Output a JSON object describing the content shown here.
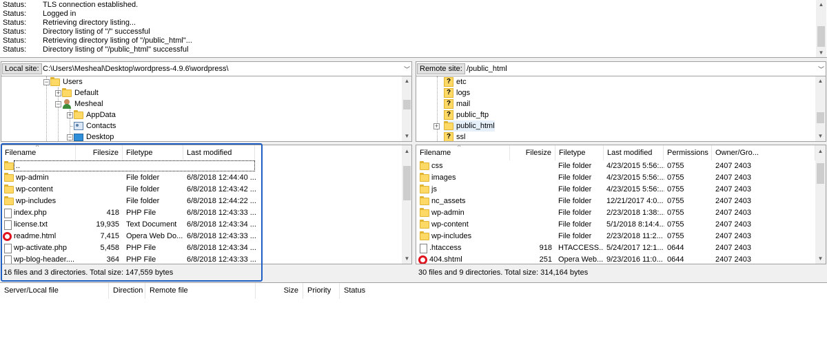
{
  "message_log": [
    {
      "label": "Status:",
      "text": "TLS connection established."
    },
    {
      "label": "Status:",
      "text": "Logged in"
    },
    {
      "label": "Status:",
      "text": "Retrieving directory listing..."
    },
    {
      "label": "Status:",
      "text": "Directory listing of \"/\" successful"
    },
    {
      "label": "Status:",
      "text": "Retrieving directory listing of \"/public_html\"..."
    },
    {
      "label": "Status:",
      "text": "Directory listing of \"/public_html\" successful"
    }
  ],
  "local": {
    "site_label": "Local site:",
    "site_path": "C:\\Users\\Mesheal\\Desktop\\wordpress-4.9.6\\wordpress\\",
    "tree": [
      {
        "label": "Users",
        "icon": "folder-icon"
      },
      {
        "label": "Default",
        "icon": "folder-icon"
      },
      {
        "label": "Mesheal",
        "icon": "user-folder-icon"
      },
      {
        "label": "AppData",
        "icon": "folder-icon"
      },
      {
        "label": "Contacts",
        "icon": "contacts-icon"
      },
      {
        "label": "Desktop",
        "icon": "desktop-icon"
      }
    ],
    "columns": {
      "filename": "Filename",
      "filesize": "Filesize",
      "filetype": "Filetype",
      "modified": "Last modified"
    },
    "files": [
      {
        "name": "..",
        "size": "",
        "type": "",
        "modified": "",
        "icon": "folder-icon"
      },
      {
        "name": "wp-admin",
        "size": "",
        "type": "File folder",
        "modified": "6/8/2018 12:44:40 ...",
        "icon": "folder-icon"
      },
      {
        "name": "wp-content",
        "size": "",
        "type": "File folder",
        "modified": "6/8/2018 12:43:42 ...",
        "icon": "folder-icon"
      },
      {
        "name": "wp-includes",
        "size": "",
        "type": "File folder",
        "modified": "6/8/2018 12:44:22 ...",
        "icon": "folder-icon"
      },
      {
        "name": "index.php",
        "size": "418",
        "type": "PHP File",
        "modified": "6/8/2018 12:43:33 ...",
        "icon": "file-icon"
      },
      {
        "name": "license.txt",
        "size": "19,935",
        "type": "Text Document",
        "modified": "6/8/2018 12:43:34 ...",
        "icon": "file-icon"
      },
      {
        "name": "readme.html",
        "size": "7,415",
        "type": "Opera Web Do...",
        "modified": "6/8/2018 12:43:33 ...",
        "icon": "opera-icon"
      },
      {
        "name": "wp-activate.php",
        "size": "5,458",
        "type": "PHP File",
        "modified": "6/8/2018 12:43:34 ...",
        "icon": "file-icon"
      },
      {
        "name": "wp-blog-header....",
        "size": "364",
        "type": "PHP File",
        "modified": "6/8/2018 12:43:33 ...",
        "icon": "file-icon"
      }
    ],
    "status": "16 files and 3 directories. Total size: 147,559 bytes"
  },
  "remote": {
    "site_label": "Remote site:",
    "site_path": "/public_html",
    "tree": [
      {
        "label": "etc",
        "icon": "unknown-folder-icon"
      },
      {
        "label": "logs",
        "icon": "unknown-folder-icon"
      },
      {
        "label": "mail",
        "icon": "unknown-folder-icon"
      },
      {
        "label": "public_ftp",
        "icon": "unknown-folder-icon"
      },
      {
        "label": "public_html",
        "icon": "folder-icon"
      },
      {
        "label": "ssl",
        "icon": "unknown-folder-icon"
      }
    ],
    "columns": {
      "filename": "Filename",
      "filesize": "Filesize",
      "filetype": "Filetype",
      "modified": "Last modified",
      "permissions": "Permissions",
      "owner": "Owner/Gro..."
    },
    "files": [
      {
        "name": "css",
        "size": "",
        "type": "File folder",
        "modified": "4/23/2015 5:56:...",
        "perm": "0755",
        "owner": "2407 2403",
        "icon": "folder-icon"
      },
      {
        "name": "images",
        "size": "",
        "type": "File folder",
        "modified": "4/23/2015 5:56:...",
        "perm": "0755",
        "owner": "2407 2403",
        "icon": "folder-icon"
      },
      {
        "name": "js",
        "size": "",
        "type": "File folder",
        "modified": "4/23/2015 5:56:...",
        "perm": "0755",
        "owner": "2407 2403",
        "icon": "folder-icon"
      },
      {
        "name": "nc_assets",
        "size": "",
        "type": "File folder",
        "modified": "12/21/2017 4:0...",
        "perm": "0755",
        "owner": "2407 2403",
        "icon": "folder-icon"
      },
      {
        "name": "wp-admin",
        "size": "",
        "type": "File folder",
        "modified": "2/23/2018 1:38:...",
        "perm": "0755",
        "owner": "2407 2403",
        "icon": "folder-icon"
      },
      {
        "name": "wp-content",
        "size": "",
        "type": "File folder",
        "modified": "5/1/2018 8:14:4...",
        "perm": "0755",
        "owner": "2407 2403",
        "icon": "folder-icon"
      },
      {
        "name": "wp-includes",
        "size": "",
        "type": "File folder",
        "modified": "2/23/2018 11:2...",
        "perm": "0755",
        "owner": "2407 2403",
        "icon": "folder-icon"
      },
      {
        "name": ".htaccess",
        "size": "918",
        "type": "HTACCESS...",
        "modified": "5/24/2017 12:1...",
        "perm": "0644",
        "owner": "2407 2403",
        "icon": "file-icon"
      },
      {
        "name": "404.shtml",
        "size": "251",
        "type": "Opera Web...",
        "modified": "9/23/2016 11:0...",
        "perm": "0644",
        "owner": "2407 2403",
        "icon": "opera-icon"
      }
    ],
    "status": "30 files and 9 directories. Total size: 314,164 bytes"
  },
  "queue": {
    "columns": {
      "server": "Server/Local file",
      "direction": "Direction",
      "remote": "Remote file",
      "size": "Size",
      "priority": "Priority",
      "status": "Status"
    }
  }
}
